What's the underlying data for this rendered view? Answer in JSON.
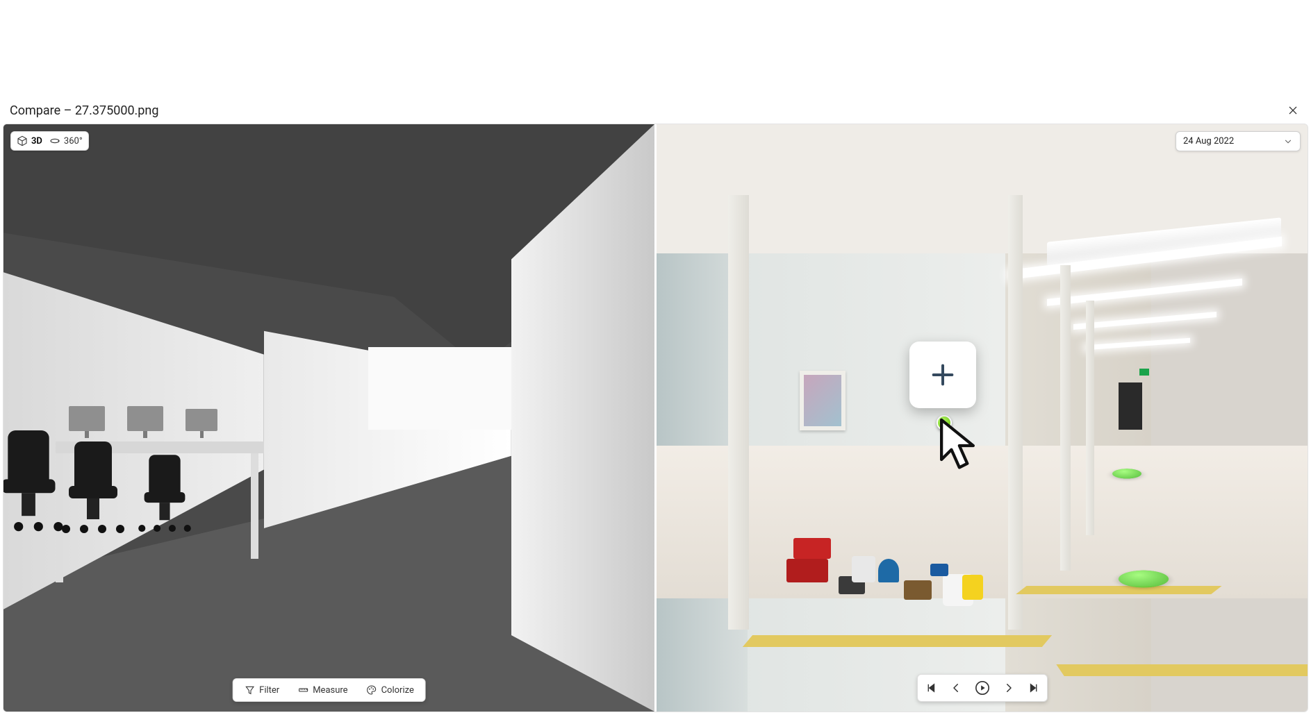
{
  "window": {
    "title": "Compare – 27.375000.png"
  },
  "left": {
    "viewModes": {
      "mode3d": "3D",
      "mode360": "360°"
    },
    "toolbar": {
      "filter": "Filter",
      "measure": "Measure",
      "colorize": "Colorize"
    }
  },
  "right": {
    "dateSelected": "24 Aug 2022"
  },
  "colors": {
    "hotspot": "#67c300"
  }
}
